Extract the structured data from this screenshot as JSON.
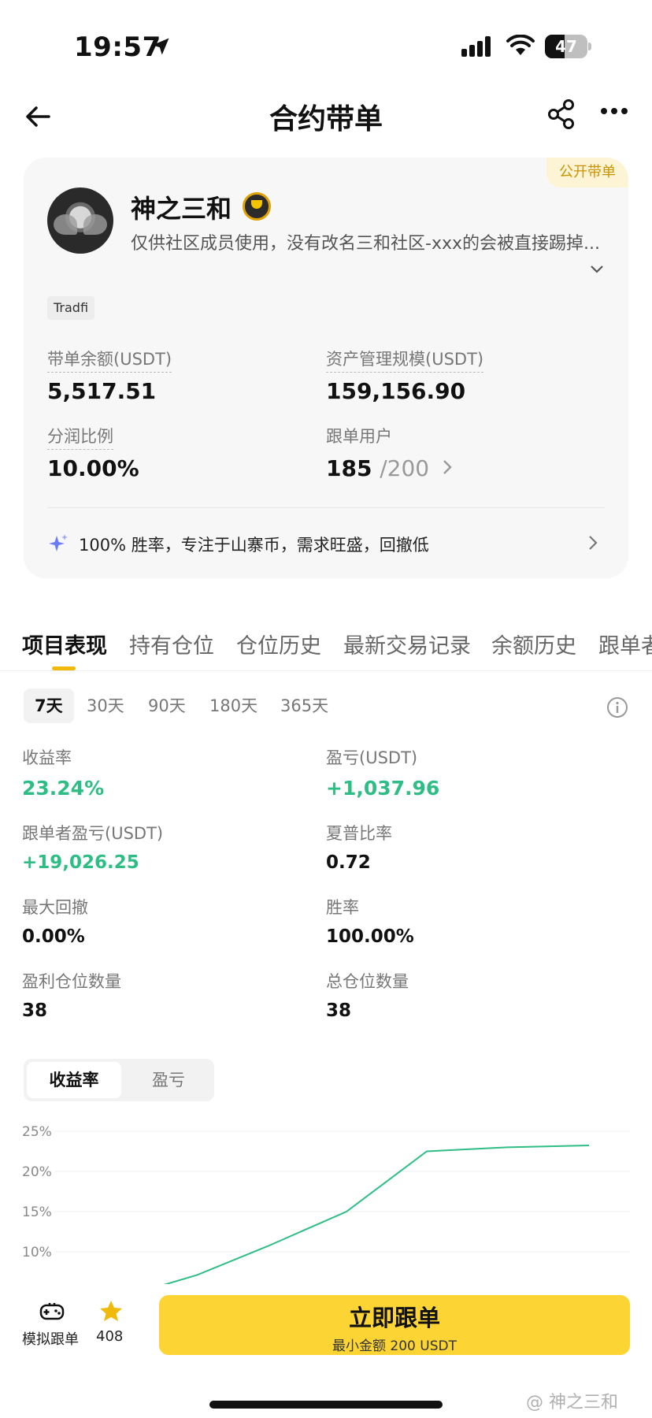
{
  "status_bar": {
    "time": "19:57",
    "battery": "47",
    "battery_level": 0.47
  },
  "nav": {
    "title": "合约带单"
  },
  "profile": {
    "badge": "公开带单",
    "name": "神之三和",
    "description": "仅供社区成员使用，没有改名三和社区-xxx的会被直接踢掉...",
    "tag": "Tradfi",
    "stats": {
      "balance_label": "带单余额(USDT)",
      "balance_value": "5,517.51",
      "aum_label": "资产管理规模(USDT)",
      "aum_value": "159,156.90",
      "share_label": "分润比例",
      "share_value": "10.00%",
      "followers_label": "跟单用户",
      "followers_value": "185",
      "followers_max": "/200"
    },
    "bio": "100% 胜率，专注于山寨币，需求旺盛，回撤低"
  },
  "tabs": [
    "项目表现",
    "持有仓位",
    "仓位历史",
    "最新交易记录",
    "余额历史",
    "跟单者"
  ],
  "periods": [
    "7天",
    "30天",
    "90天",
    "180天",
    "365天"
  ],
  "metrics": {
    "roi_label": "收益率",
    "roi_value": "23.24%",
    "pnl_label": "盈亏(USDT)",
    "pnl_value": "+1,037.96",
    "copier_pnl_label": "跟单者盈亏(USDT)",
    "copier_pnl_value": "+19,026.25",
    "sharpe_label": "夏普比率",
    "sharpe_value": "0.72",
    "mdd_label": "最大回撤",
    "mdd_value": "0.00%",
    "winrate_label": "胜率",
    "winrate_value": "100.00%",
    "win_pos_label": "盈利仓位数量",
    "win_pos_value": "38",
    "total_pos_label": "总仓位数量",
    "total_pos_value": "38"
  },
  "segment": [
    "收益率",
    "盈亏"
  ],
  "chart_data": {
    "type": "line",
    "y_ticks": [
      "25%",
      "20%",
      "15%",
      "10%"
    ],
    "ylim": [
      10,
      25
    ],
    "x": [
      1,
      2,
      3,
      4,
      5,
      6,
      7
    ],
    "series": [
      {
        "values": [
          4.5,
          7.1,
          10.7,
          15.0,
          22.5,
          23.0,
          23.24
        ]
      }
    ],
    "grid": true,
    "line_color": "#2ebd85"
  },
  "bottom": {
    "sim_label": "模拟跟单",
    "star_count": "408",
    "cta_main": "立即跟单",
    "cta_sub": "最小金额 200 USDT",
    "watermark": "@ 神之三和"
  },
  "colors": {
    "accent": "#fcd535",
    "positive": "#2ebd85",
    "badge_text": "#c99400"
  }
}
